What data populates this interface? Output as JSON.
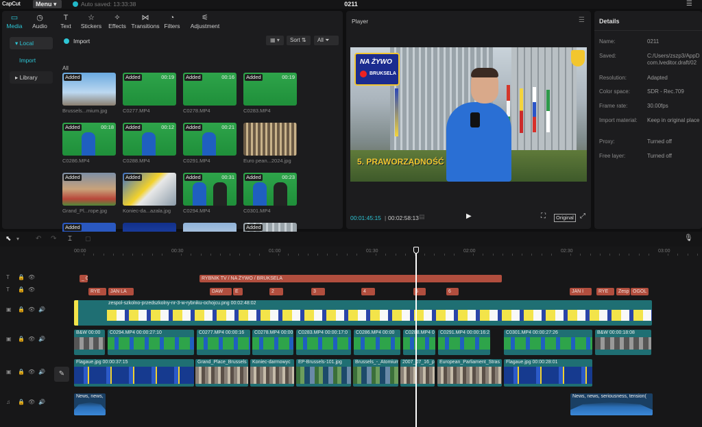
{
  "app": {
    "logo": "CapCut",
    "menu_label": "Menu",
    "autosave": "Auto saved: 13:33:38",
    "project_title": "0211"
  },
  "tabs": [
    {
      "label": "Media",
      "icon": "media-icon"
    },
    {
      "label": "Audio",
      "icon": "audio-icon"
    },
    {
      "label": "Text",
      "icon": "text-icon"
    },
    {
      "label": "Stickers",
      "icon": "stickers-icon"
    },
    {
      "label": "Effects",
      "icon": "effects-icon"
    },
    {
      "label": "Transitions",
      "icon": "transitions-icon"
    },
    {
      "label": "Filters",
      "icon": "filters-icon"
    },
    {
      "label": "Adjustment",
      "icon": "adjustment-icon"
    }
  ],
  "sidebar": {
    "local": "Local",
    "import": "Import",
    "library": "Library"
  },
  "media": {
    "import_label": "Import",
    "sort_label": "Sort",
    "filter_label": "All",
    "section": "All",
    "items": [
      {
        "name": "Brussels...mium.jpg",
        "badge": "Added",
        "duration": ""
      },
      {
        "name": "C0277.MP4",
        "badge": "Added",
        "duration": "00:19"
      },
      {
        "name": "C0278.MP4",
        "badge": "Added",
        "duration": "00:16"
      },
      {
        "name": "C0283.MP4",
        "badge": "Added",
        "duration": "00:19"
      },
      {
        "name": "C0286.MP4",
        "badge": "Added",
        "duration": "00:18"
      },
      {
        "name": "C0288.MP4",
        "badge": "Added",
        "duration": "00:12"
      },
      {
        "name": "C0291.MP4",
        "badge": "Added",
        "duration": "00:21"
      },
      {
        "name": "Euro pean...2024.jpg",
        "badge": "",
        "duration": ""
      },
      {
        "name": "Grand_Pl...rope.jpg",
        "badge": "Added",
        "duration": ""
      },
      {
        "name": "Koniec-da...azala.jpg",
        "badge": "Added",
        "duration": ""
      },
      {
        "name": "C0294.MP4",
        "badge": "Added",
        "duration": "00:31"
      },
      {
        "name": "C0301.MP4",
        "badge": "Added",
        "duration": "00:23"
      },
      {
        "name": "",
        "badge": "Added",
        "duration": ""
      },
      {
        "name": "",
        "badge": "",
        "duration": ""
      },
      {
        "name": "",
        "badge": "",
        "duration": ""
      },
      {
        "name": "",
        "badge": "Added",
        "duration": ""
      }
    ]
  },
  "player": {
    "title": "Player",
    "current_time": "00:01:45:15",
    "total_time": "00:02:58:13",
    "ratio_label": "Original",
    "overlay_live": "NA ŻYWO",
    "overlay_city": "BRUKSELA",
    "overlay_caption": "5. PRAWORZĄDNOŚĆ"
  },
  "details": {
    "title": "Details",
    "rows": [
      {
        "label": "Name:",
        "value": "0211"
      },
      {
        "label": "Saved:",
        "value": "C:/Users/zszp3/AppD"
      },
      {
        "label": "",
        "value": "com.lveditor.draft/02"
      },
      {
        "label": "Resolution:",
        "value": "Adapted"
      },
      {
        "label": "Color space:",
        "value": "SDR - Rec.709"
      },
      {
        "label": "Frame rate:",
        "value": "30.00fps"
      },
      {
        "label": "Import material:",
        "value": "Keep in original place"
      },
      {
        "label": "Proxy:",
        "value": "Turned off"
      },
      {
        "label": "Free layer:",
        "value": "Turned off"
      }
    ]
  },
  "ruler": [
    "00:00",
    "00:30",
    "01:00",
    "01:30",
    "02:00",
    "02:30",
    "03:00"
  ],
  "tracks": {
    "text1": [
      {
        "label": "_ O("
      },
      {
        "label": "RYBNIK TV / NA ŻYWO / BRUKSELA"
      }
    ],
    "text2": [
      {
        "label": "RYE"
      },
      {
        "label": "JAN LA"
      },
      {
        "label": "DAW"
      },
      {
        "label": "E"
      },
      {
        "label": "2"
      },
      {
        "label": "3"
      },
      {
        "label": "4"
      },
      {
        "label": "5"
      },
      {
        "label": "6"
      },
      {
        "label": "JAN I"
      },
      {
        "label": "RYE"
      },
      {
        "label": "Zesp"
      },
      {
        "label": "OGOL"
      }
    ],
    "overlay": {
      "label": "zespol-szkolno-przedszkolny-nr-3-w-rybniku-ochojcu.png  00:02:48:02",
      "start": "2"
    },
    "video": [
      {
        "label": "B&W  00:00"
      },
      {
        "label": "C0294.MP4  00:00:27:10"
      },
      {
        "label": "C0277.MP4  00:00:16"
      },
      {
        "label": "C0278.MP4  00:00:1"
      },
      {
        "label": "C0283.MP4  00:00:17:0"
      },
      {
        "label": "C0286.MP4  00:00"
      },
      {
        "label": "C0288.MP4  0"
      },
      {
        "label": "C0291.MP4  00:00:16:2"
      },
      {
        "label": "C0301.MP4  00:00:27:26"
      },
      {
        "label": "B&W  00:00:18:08"
      }
    ],
    "images": [
      {
        "label": "Flagaue.jpg  00:00:37:15"
      },
      {
        "label": "Grand_Place_Brussels"
      },
      {
        "label": "Koniec-darmowyc"
      },
      {
        "label": "EP-Brussels-101.jpg"
      },
      {
        "label": "Brussels_-_Atomium"
      },
      {
        "label": "2007_07_16_p"
      },
      {
        "label": "European_Parliament_Stras"
      },
      {
        "label": "Flagaue.jpg  00:00:28:01"
      }
    ],
    "audio": [
      {
        "label": "News, news,"
      },
      {
        "label": "News, news, seriousness, tension("
      }
    ]
  },
  "colors": {
    "accent": "#2ec6d6",
    "text_clip": "#b14e3e",
    "video_track": "#1f6f73",
    "playhead": "#ffffff"
  }
}
